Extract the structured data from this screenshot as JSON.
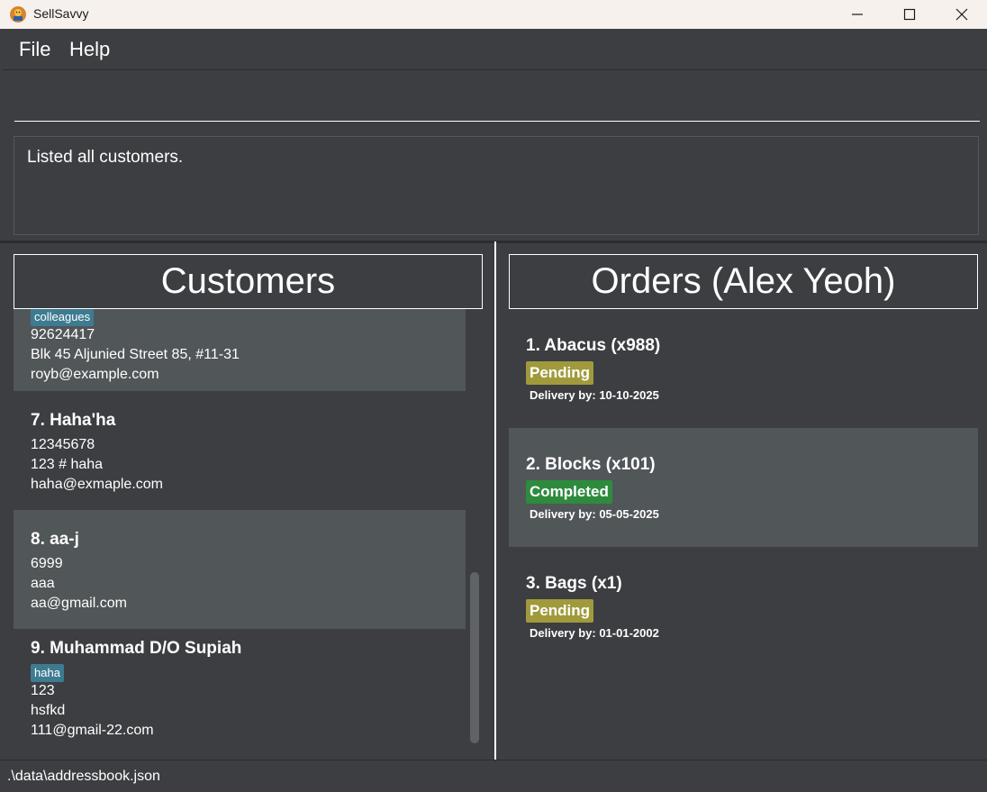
{
  "window": {
    "title": "SellSavvy",
    "icon": "app-logo-icon",
    "controls": [
      "minimize-icon",
      "maximize-icon",
      "close-icon"
    ]
  },
  "menu": {
    "file": "File",
    "help": "Help"
  },
  "command": {
    "value": "",
    "placeholder": ""
  },
  "result": {
    "message": "Listed all customers."
  },
  "customers_panel": {
    "title": "Customers",
    "items": [
      {
        "name": "",
        "tags": [
          "colleagues"
        ],
        "phone": "92624417",
        "address": "Blk 45 Aljunied Street 85, #11-31",
        "email": "royb@example.com"
      },
      {
        "name": "7. Haha'ha",
        "tags": [],
        "phone": "12345678",
        "address": "123 # haha",
        "email": "haha@exmaple.com"
      },
      {
        "name": "8. aa-j",
        "tags": [],
        "phone": "6999",
        "address": "aaa",
        "email": "aa@gmail.com"
      },
      {
        "name": "9. Muhammad D/O Supiah",
        "tags": [
          "haha"
        ],
        "phone": "123",
        "address": "hsfkd",
        "email": "111@gmail-22.com"
      }
    ]
  },
  "orders_panel": {
    "title": "Orders (Alex Yeoh)",
    "items": [
      {
        "title": "1. Abacus (x988)",
        "status": "Pending",
        "delivery": "Delivery by: 10-10-2025"
      },
      {
        "title": "2. Blocks (x101)",
        "status": "Completed",
        "delivery": "Delivery by: 05-05-2025"
      },
      {
        "title": "3. Bags (x1)",
        "status": "Pending",
        "delivery": "Delivery by: 01-01-2002"
      }
    ]
  },
  "colors": {
    "pending": "#a09a3c",
    "completed": "#2e8b3e",
    "tag": "#3e7b91"
  },
  "statusbar": {
    "path": ".\\data\\addressbook.json"
  }
}
